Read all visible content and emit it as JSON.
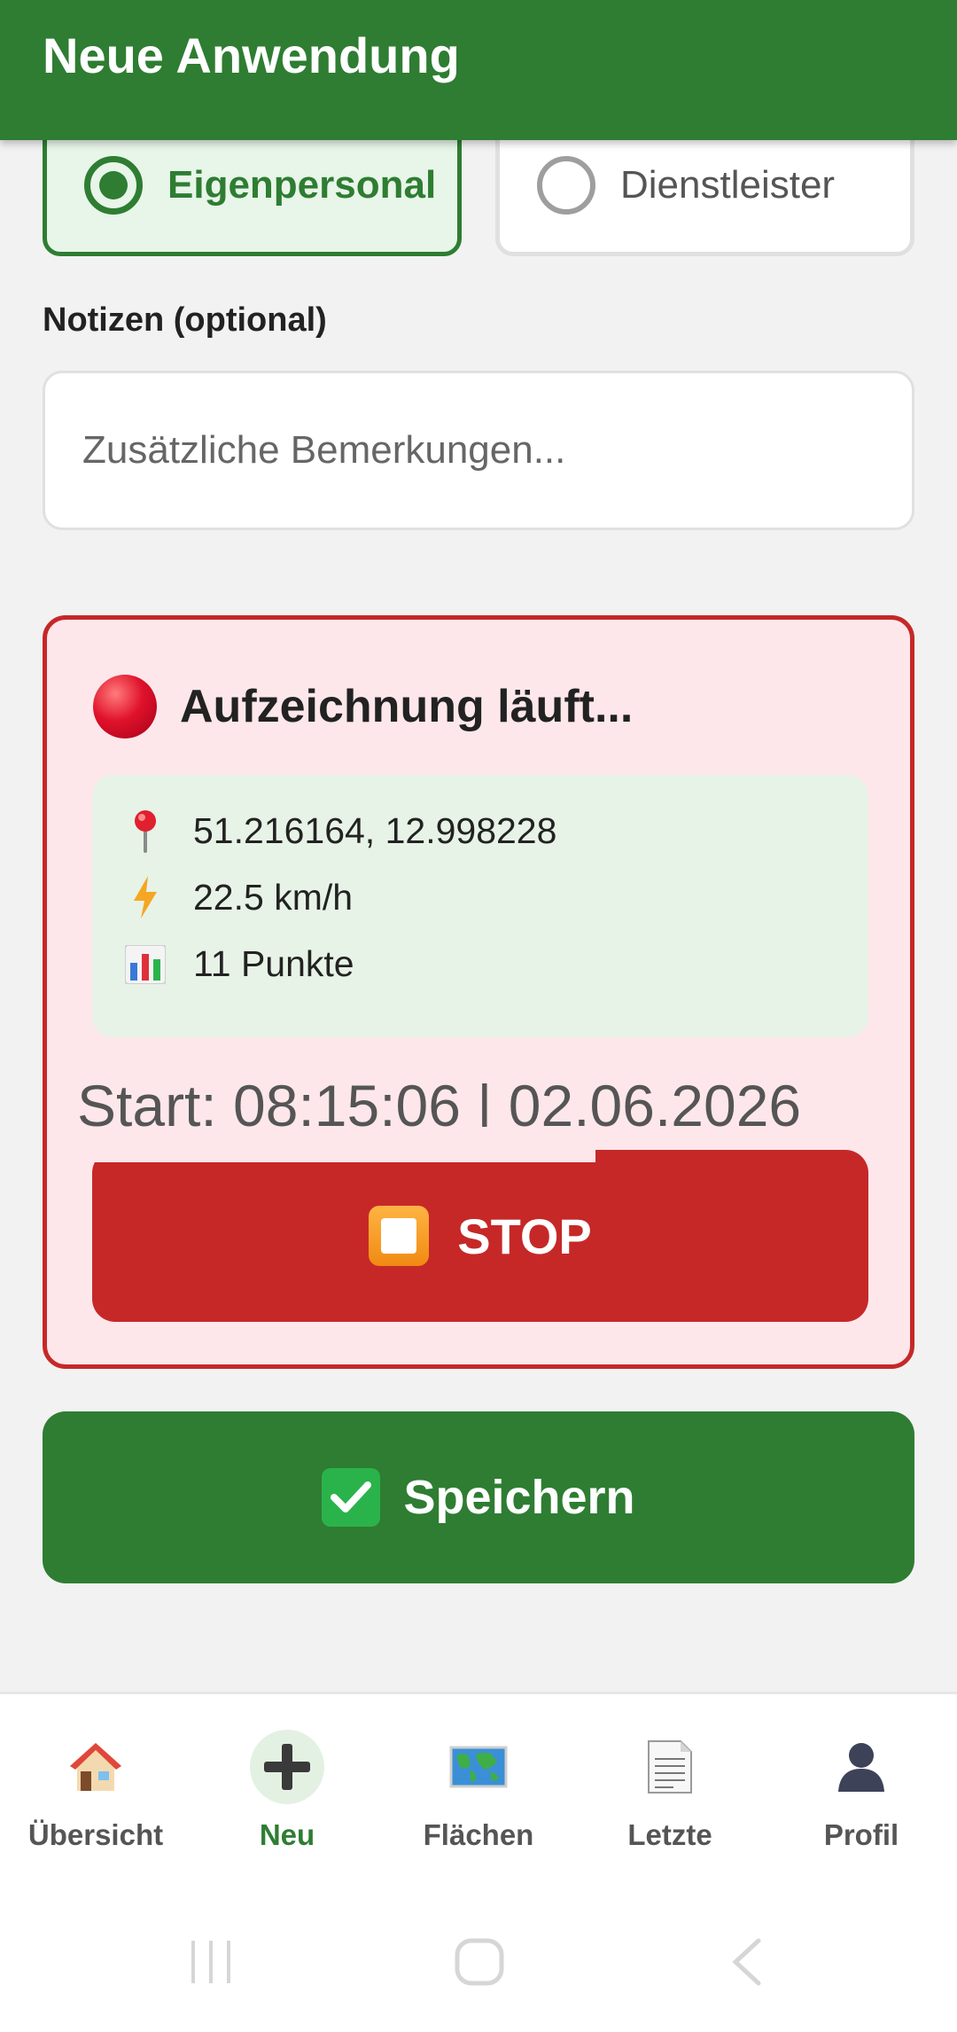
{
  "app_bar": {
    "title": "Neue Anwendung"
  },
  "personnel": {
    "options": [
      {
        "label": "Eigenpersonal",
        "selected": true
      },
      {
        "label": "Dienstleister",
        "selected": false
      }
    ]
  },
  "notes": {
    "label": "Notizen (optional)",
    "placeholder": "Zusätzliche Bemerkungen...",
    "value": ""
  },
  "recording": {
    "title": "Aufzeichnung läuft...",
    "status_icon": "red-circle-icon",
    "coordinates": "51.216164, 12.998228",
    "speed": "22.5 km/h",
    "points": "11 Punkte",
    "start_text": "Start: 08:15:06 | 02.06.2026",
    "stop_label": "STOP"
  },
  "save": {
    "label": "Speichern"
  },
  "bottom_nav": {
    "active": "Neu",
    "items": [
      {
        "label": "Übersicht",
        "icon": "house-icon"
      },
      {
        "label": "Neu",
        "icon": "plus-icon"
      },
      {
        "label": "Flächen",
        "icon": "world-map-icon"
      },
      {
        "label": "Letzte",
        "icon": "document-icon"
      },
      {
        "label": "Profil",
        "icon": "user-silhouette-icon"
      }
    ]
  },
  "colors": {
    "primary": "#2e7d32",
    "danger": "#c62828",
    "recording_bg": "#fde7ea",
    "info_bg": "#e7f3e6"
  }
}
